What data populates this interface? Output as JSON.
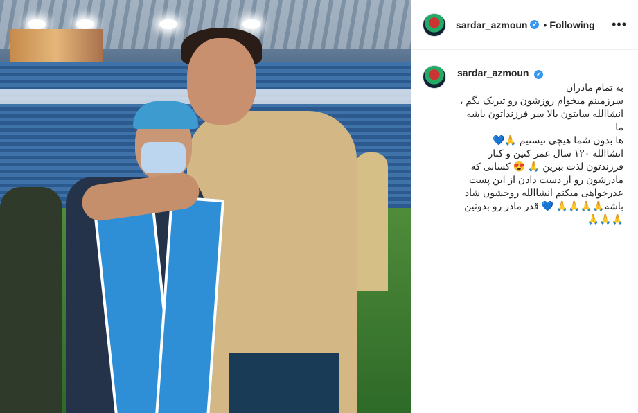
{
  "post": {
    "username": "sardar_azmoun",
    "follow_separator": "•",
    "follow_status": "Following",
    "more_icon": "more-options-icon",
    "caption": "به تمام مادران\nسرزمینم میخوام روزشون رو تبریک بگم ،\nانشاالله سایتون بالا سر فرزنداتون باشه ما\nها بدون شما هیچی نیستیم 🙏💙\nانشاالله ۱۲۰ سال عمر کنین و کنار\nفرزندتون لذت ببرین 🙏 😍 کسانی که\nمادرشون رو از دست دادن از این پست\nعذرخواهی میکنم انشاالله روحشون شاد\nباشه🙏🙏🙏🙏 💙 قدر مادر رو بدونین\n🙏🙏🙏"
  },
  "colors": {
    "verified": "#3897f0",
    "border": "#efefef",
    "text": "#262626"
  }
}
